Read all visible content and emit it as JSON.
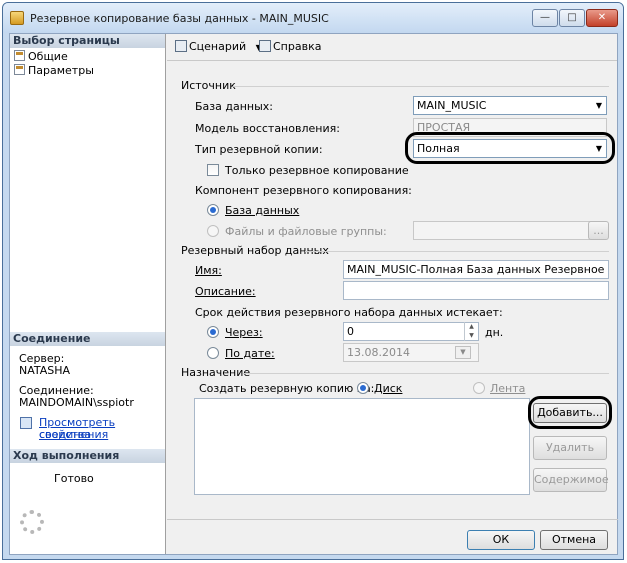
{
  "window": {
    "title": "Резервное копирование базы данных - MAIN_MUSIC",
    "minimize_glyph": "—",
    "maximize_glyph": "□",
    "close_glyph": "✕"
  },
  "sidebar": {
    "pages_header": "Выбор страницы",
    "items": [
      {
        "label": "Общие",
        "icon": "page-icon"
      },
      {
        "label": "Параметры",
        "icon": "page-icon"
      }
    ],
    "connection_header": "Соединение",
    "server_label": "Сервер:",
    "server_value": "NATASHA",
    "connection_label": "Соединение:",
    "connection_value": "MAINDOMAIN\\sspiotr",
    "view_props_link_line1": "Просмотреть свойства",
    "view_props_link_line2": "соединения",
    "progress_header": "Ход выполнения",
    "progress_status": "Готово"
  },
  "toolbar": {
    "script_label": "Сценарий",
    "script_dropdown_glyph": "▼",
    "help_label": "Справка"
  },
  "source": {
    "group_label": "Источник",
    "database_label": "База данных:",
    "database_value": "MAIN_MUSIC",
    "recovery_label": "Модель восстановления:",
    "recovery_value": "ПРОСТАЯ",
    "backup_type_label": "Тип резервной копии:",
    "backup_type_value": "Полная",
    "copy_only_label": "Только резервное копирование",
    "copy_only_checked": false,
    "component_label": "Компонент резервного копирования:",
    "component_database_label": "База данных",
    "component_files_label": "Файлы и файловые группы:",
    "files_browse_label": "...",
    "combo_arrow": "▼"
  },
  "backup_set": {
    "group_label": "Резервный набор данных",
    "name_label": "Имя:",
    "name_value": "MAIN_MUSIC-Полная База данных Резервное копировани",
    "description_label": "Описание:",
    "description_value": "",
    "expires_label": "Срок действия резервного набора данных истекает:",
    "after_label": "Через:",
    "after_value": "0",
    "after_unit": "дн.",
    "on_label": "По дате:",
    "on_value": "13.08.2014",
    "spin_up": "▲",
    "spin_down": "▼"
  },
  "destination": {
    "group_label": "Назначение",
    "backup_to_label": "Создать резервную копию на:",
    "disk_label": "Диск",
    "tape_label": "Лента",
    "add_button": "Добавить...",
    "remove_button": "Удалить",
    "contents_button": "Содержимое"
  },
  "footer": {
    "ok_button": "ОК",
    "cancel_button": "Отмена"
  }
}
